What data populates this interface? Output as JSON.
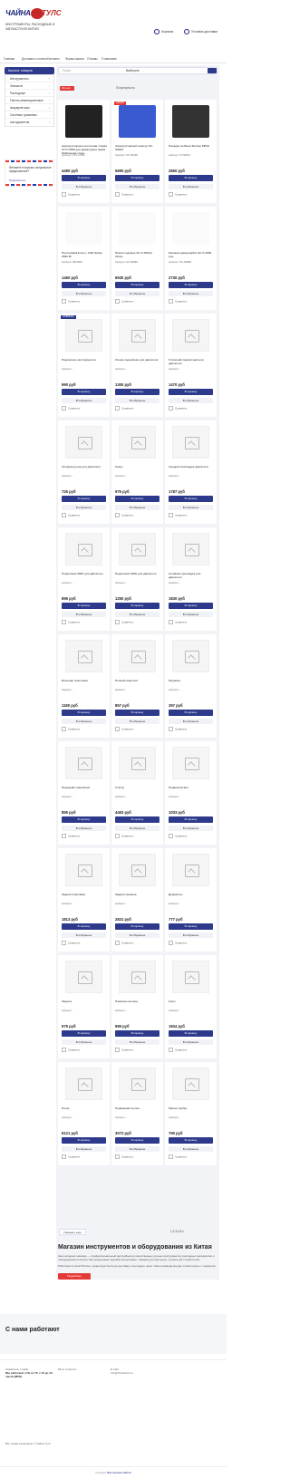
{
  "header": {
    "logo_left": "ЧАЙНА",
    "logo_right": "ТУЛС",
    "tagline": "ИНСТРУМЕНТЫ, РАСХОДНЫЕ И ЗАПЧАСТИ ИЗ КИТАЯ",
    "phone": "Корзина",
    "delivery": "Условия доставки",
    "nav": [
      "Главная",
      "Доставка и оплата",
      "Контакты",
      "Форма заказа",
      "Отзывы",
      "О магазине"
    ]
  },
  "catalog": {
    "button": "Каталог товаров",
    "items": [
      "Инструменты",
      "Запчасти",
      "Расходные",
      "Гаечно-инжиниринговое",
      "Аккумуляторы",
      "Системы грошевых инструментов"
    ]
  },
  "promo": {
    "title": "Желаете получать актуальное предложение?",
    "link": "Подписаться"
  },
  "search": {
    "placeholder": "Поиск",
    "category": "Выберите",
    "sort": "Популярность"
  },
  "filter_button": "Фильтр",
  "products": [
    {
      "name": "Аккумуляторная ленточная стяжка ZY2 С36М для арматурных ферм Мобильная сталь",
      "code": "Артикул: ZY2-C36M",
      "price": "4490 руб",
      "badge": ""
    },
    {
      "name": "Аккумуляторный секатор SC-S5400",
      "code": "Артикул: SC-S5400",
      "price": "5690 руб",
      "badge": "АКЦИЯ"
    },
    {
      "name": "Насадка на Вашу Болгар MINI4",
      "code": "Артикул: ZY-MINI4",
      "price": "2850 руб",
      "badge": ""
    },
    {
      "name": "Портал/двигатель с АКБ Зубры 2500 Вт",
      "code": "Артикул: ZB-2500",
      "price": "1450 руб",
      "badge": ""
    },
    {
      "name": "Ножни ходовые SC-S 2890 в сборе",
      "code": "Артикул: SC-S2890",
      "price": "6930 руб",
      "badge": ""
    },
    {
      "name": "Механик движущийся SC-S 2890 для",
      "code": "Артикул: SC-S2890",
      "price": "2730 руб",
      "badge": ""
    },
    {
      "name": "Нарезатель инструментов",
      "code": "Артикул: -",
      "price": "990 руб",
      "badge": "НОВИНКА"
    },
    {
      "name": "Опора подшипник для двигателя",
      "code": "Артикул: -",
      "price": "1300 руб",
      "badge": ""
    },
    {
      "name": "Отключай поворотный для двигателя",
      "code": "Артикул: -",
      "price": "1470 руб",
      "badge": ""
    },
    {
      "name": "Опорная ручка для двигателя",
      "code": "Артикул: -",
      "price": "725 руб",
      "badge": ""
    },
    {
      "name": "Кожух",
      "code": "Артикул: -",
      "price": "975 руб",
      "badge": ""
    },
    {
      "name": "Средняя прокладка двигателя",
      "code": "Артикул: -",
      "price": "1787 руб",
      "badge": ""
    },
    {
      "name": "Подшипник 6000 для двигателя",
      "code": "Артикул: -",
      "price": "895 руб",
      "badge": ""
    },
    {
      "name": "Подшипник 6000 для двигателя",
      "code": "Артикул: -",
      "price": "1250 руб",
      "badge": ""
    },
    {
      "name": "Активная прокладка для двигателя",
      "code": "Артикул: -",
      "price": "1830 руб",
      "badge": ""
    },
    {
      "name": "Большая пластинка",
      "code": "Артикул: -",
      "price": "1180 руб",
      "badge": ""
    },
    {
      "name": "Полный комплект",
      "code": "Артикул: -",
      "price": "857 руб",
      "badge": ""
    },
    {
      "name": "Пружина",
      "code": "Артикул: -",
      "price": "397 руб",
      "badge": ""
    },
    {
      "name": "Передний подшипник",
      "code": "Артикул: -",
      "price": "855 руб",
      "badge": ""
    },
    {
      "name": "Статор",
      "code": "Артикул: -",
      "price": "4463 руб",
      "badge": ""
    },
    {
      "name": "Подвесной вал",
      "code": "Артикул: -",
      "price": "1033 руб",
      "badge": ""
    },
    {
      "name": "Задняя подставка",
      "code": "Артикул: -",
      "price": "1813 руб",
      "badge": ""
    },
    {
      "name": "Задняя пружина",
      "code": "Артикул: -",
      "price": "2831 руб",
      "badge": ""
    },
    {
      "name": "Держатель",
      "code": "Артикул: -",
      "price": "777 руб",
      "badge": ""
    },
    {
      "name": "Защита",
      "code": "Артикул: -",
      "price": "975 руб",
      "badge": ""
    },
    {
      "name": "Нажатая колонка",
      "code": "Артикул: -",
      "price": "999 руб",
      "badge": ""
    },
    {
      "name": "Ключ",
      "code": "Артикул: -",
      "price": "1834 руб",
      "badge": ""
    },
    {
      "name": "Ротор",
      "code": "Артикул: -",
      "price": "9121 руб",
      "badge": ""
    },
    {
      "name": "Подвижная втулка",
      "code": "Артикул: -",
      "price": "3072 руб",
      "badge": ""
    },
    {
      "name": "Малая трубка",
      "code": "Артикул: -",
      "price": "790 руб",
      "badge": ""
    }
  ],
  "card_labels": {
    "buy": "В корзину",
    "fav": "В избранное",
    "compare": "Сравнить"
  },
  "pagination": {
    "more": "Показать еще",
    "pages": "1  2  3  4  5  »"
  },
  "seo": {
    "title": "Магазин инструментов и оборудования из Китая",
    "p1": "Наш интернет-магазин — профессиональный дистрибьютор качественных ручных инструментов, расходных материалов и оборудования из Китая. Мы предлагаем широкий ассортимент товаров для мастеров, строителей и любителей.",
    "p2": "Работаем по всей России, гарантируя быструю доставку и выгодные цены. Наша команда всегда готова помочь с подбором.",
    "button": "Подробнее"
  },
  "partners_title": "С нами работают",
  "footer": {
    "col1_label": "Свяжитесь с нами",
    "col1_value": "Мы работаем с Пн по Пт с 10 до 19 часов (МСК)",
    "col2_label": "Мы в соцсетях",
    "col3_label": "E-mail",
    "col3_value": "info@chinatools.ru",
    "copy": "Все права защищены © Чайна Тулс",
    "dev_prefix": "Создано",
    "dev_name": "Мастерская сайтов"
  },
  "colors": {
    "brand": "#2d3a8c",
    "accent": "#e53935"
  }
}
